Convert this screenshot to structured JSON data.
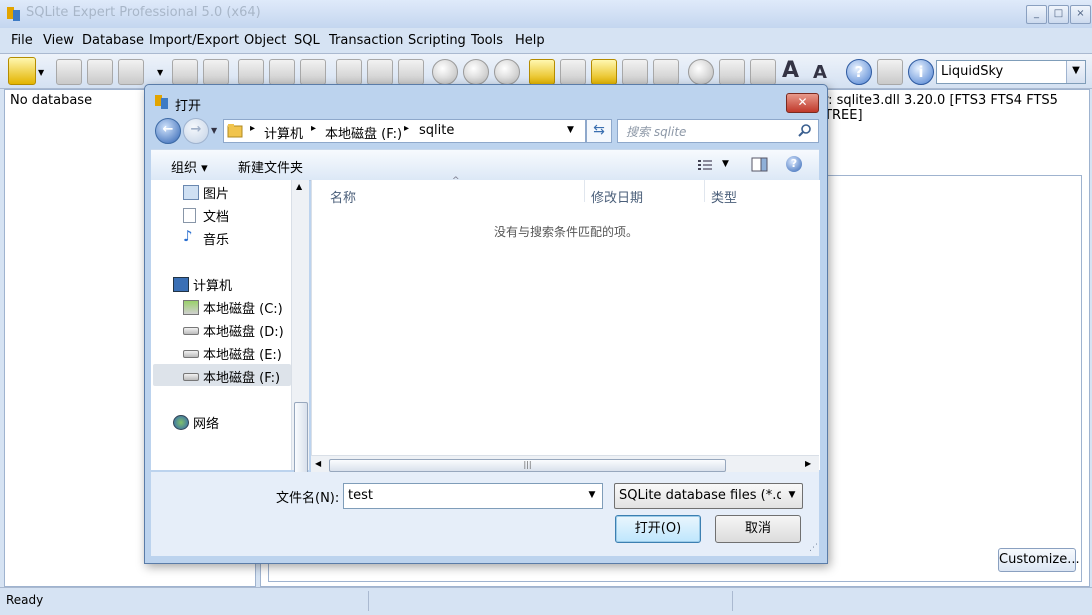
{
  "app": {
    "title": "SQLite Expert Professional 5.0 (x64)",
    "window_buttons": {
      "minimize": "_",
      "maximize": "□",
      "close": "×"
    }
  },
  "menu": [
    "File",
    "View",
    "Database",
    "Import/Export",
    "Object",
    "SQL",
    "Transaction",
    "Scripting",
    "Tools",
    "Help"
  ],
  "toolbar": {
    "skin_select": "LiquidSky",
    "icons": [
      "open-database-icon",
      "dropdown-icon",
      "detach-database-icon",
      "vacuum-icon",
      "backup-icon",
      "dropdown-icon",
      "attach-icon",
      "import-icon",
      "new-table-icon",
      "edit-table-icon",
      "drop-table-icon",
      "sql-editor-icon",
      "execute-sql-icon",
      "execute-current-icon",
      "play-icon",
      "stop-icon",
      "rewind-icon",
      "script-icon",
      "script-run-icon",
      "script-stop-icon",
      "script-edit-icon",
      "script-debug-icon",
      "settings-icon",
      "copy-icon",
      "paste-icon",
      "font-increase-icon",
      "font-decrease-icon",
      "help-icon",
      "update-icon",
      "info-icon"
    ]
  },
  "left_pane": {
    "text": "No database"
  },
  "right_pane": {
    "library_info": "ry: sqlite3.dll 3.20.0 [FTS3 FTS4 FTS5 RTREE]",
    "customize_label": "Customize..."
  },
  "status": {
    "text": "Ready"
  },
  "dialog": {
    "title": "打开",
    "close": "✕",
    "path": [
      "计算机",
      "本地磁盘 (F:)",
      "sqlite"
    ],
    "search_placeholder": "搜索 sqlite",
    "organize_label": "组织 ▾",
    "new_folder_label": "新建文件夹",
    "nav_items": [
      {
        "label": "图片",
        "icon": "pictures-icon"
      },
      {
        "label": "文档",
        "icon": "documents-icon"
      },
      {
        "label": "音乐",
        "icon": "music-icon"
      },
      {
        "label": "计算机",
        "icon": "computer-icon"
      },
      {
        "label": "本地磁盘 (C:)",
        "icon": "system-drive-icon"
      },
      {
        "label": "本地磁盘 (D:)",
        "icon": "drive-icon"
      },
      {
        "label": "本地磁盘 (E:)",
        "icon": "drive-icon"
      },
      {
        "label": "本地磁盘 (F:)",
        "icon": "drive-icon",
        "selected": true
      },
      {
        "label": "网络",
        "icon": "network-icon"
      }
    ],
    "columns": [
      "名称",
      "修改日期",
      "类型"
    ],
    "empty_message": "没有与搜索条件匹配的项。",
    "filename_label": "文件名(N):",
    "filename_value": "test",
    "filetype_value": "SQLite database files (*.db, *.",
    "open_label": "打开(O)",
    "cancel_label": "取消"
  },
  "colors": {
    "accent": "#3c7fb1",
    "frame": "#bcd3ee",
    "close_red": "#c0392b"
  }
}
